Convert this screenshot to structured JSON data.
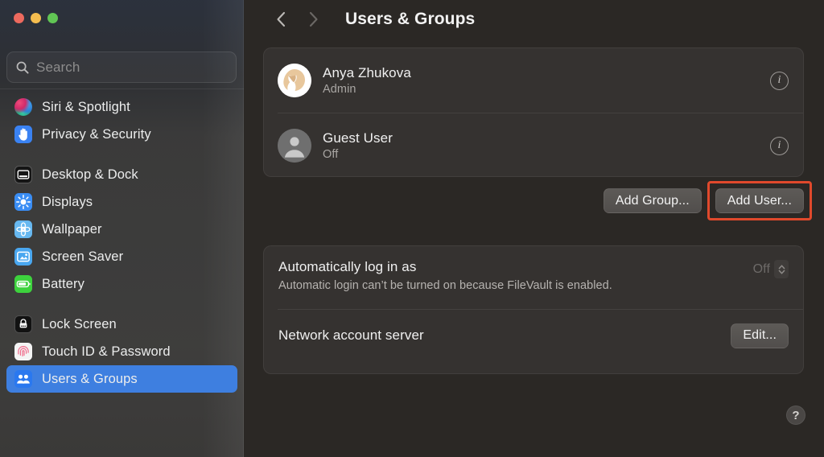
{
  "window": {
    "traffic_lights": [
      {
        "name": "close",
        "color": "#ed6a5e"
      },
      {
        "name": "minimize",
        "color": "#f5bd4f"
      },
      {
        "name": "zoom",
        "color": "#61c554"
      }
    ]
  },
  "sidebar": {
    "search": {
      "placeholder": "Search"
    },
    "groups": [
      {
        "items": [
          {
            "label": "Siri & Spotlight",
            "icon": "siri-icon"
          },
          {
            "label": "Privacy & Security",
            "icon": "hand-icon"
          }
        ]
      },
      {
        "items": [
          {
            "label": "Desktop & Dock",
            "icon": "desktop-icon"
          },
          {
            "label": "Displays",
            "icon": "brightness-icon"
          },
          {
            "label": "Wallpaper",
            "icon": "flower-icon"
          },
          {
            "label": "Screen Saver",
            "icon": "screensaver-icon"
          },
          {
            "label": "Battery",
            "icon": "battery-icon"
          }
        ]
      },
      {
        "items": [
          {
            "label": "Lock Screen",
            "icon": "lock-icon"
          },
          {
            "label": "Touch ID & Password",
            "icon": "fingerprint-icon"
          },
          {
            "label": "Users & Groups",
            "icon": "users-icon",
            "selected": true
          }
        ]
      }
    ],
    "selected_color": "#3e7fe0"
  },
  "header": {
    "back_label": "‹",
    "forward_label": "›",
    "title": "Users & Groups"
  },
  "users": [
    {
      "name": "Anya Zhukova",
      "status": "Admin",
      "avatar": "anya-avatar",
      "info_label": "i"
    },
    {
      "name": "Guest User",
      "status": "Off",
      "avatar": "guest-avatar",
      "info_label": "i"
    }
  ],
  "actions": {
    "add_group": "Add Group...",
    "add_user": "Add User...",
    "annotation_color": "#e0492c"
  },
  "options": {
    "auto_login": {
      "title": "Automatically log in as",
      "description": "Automatic login can’t be turned on because FileVault is enabled.",
      "value": "Off"
    },
    "network_account_server": {
      "title": "Network account server",
      "button": "Edit..."
    }
  },
  "help": {
    "label": "?"
  }
}
